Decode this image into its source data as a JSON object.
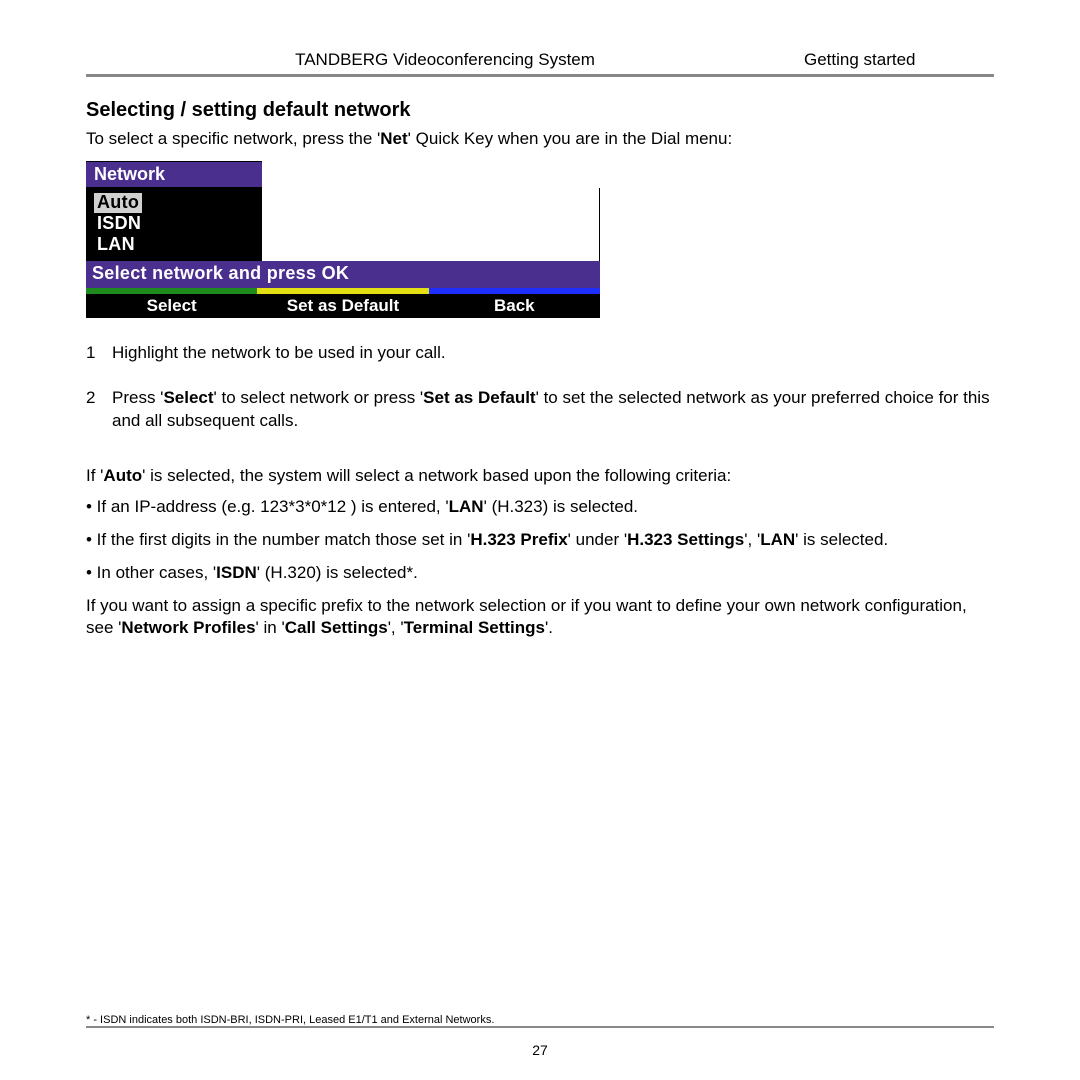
{
  "header": {
    "center": "TANDBERG Videoconferencing System",
    "right": "Getting started"
  },
  "heading": "Selecting / setting default network",
  "intro": {
    "pre": "To select a specific network, press the '",
    "bold": "Net",
    "post": "' Quick Key when you are in the Dial menu:"
  },
  "screenshot": {
    "title": "Network",
    "options": [
      "Auto",
      "ISDN",
      "LAN"
    ],
    "selected_index": 0,
    "prompt": "Select network and press OK",
    "buttons": [
      "Select",
      "Set as Default",
      "Back"
    ]
  },
  "steps": [
    {
      "num": "1",
      "pre": "Highlight the network to be used in your call."
    },
    {
      "num": "2",
      "pre": "Press '",
      "b1": "Select",
      "mid": "' to select network or press '",
      "b2": "Set as Default",
      "post": "' to set the selected network as your preferred choice for this and all subsequent calls."
    }
  ],
  "auto_line": {
    "pre": "If '",
    "b": "Auto",
    "post": "' is selected, the system will select a network based upon the following criteria:"
  },
  "bullets": [
    {
      "pre": "• If an IP-address (e.g. 123*3*0*12 ) is entered, '",
      "b": "LAN",
      "post": "' (H.323) is selected."
    },
    {
      "pre": "• If the first digits in the number match those set in '",
      "b1": "H.323 Prefix",
      "mid": "' under '",
      "b2": "H.323 Settings",
      "mid2": "', '",
      "b3": "LAN",
      "post": "' is selected."
    },
    {
      "pre": "• In other cases, '",
      "b": "ISDN",
      "post": "' (H.320) is selected*."
    }
  ],
  "closing": {
    "pre": "If you want to assign a specific prefix to the network selection or if you want to define your own network configuration, see '",
    "b1": "Network Profiles",
    "mid1": "' in '",
    "b2": "Call Settings",
    "mid2": "', '",
    "b3": "Terminal Settings",
    "post": "'."
  },
  "footnote": "* - ISDN indicates both ISDN-BRI, ISDN-PRI, Leased E1/T1 and External Networks.",
  "page_number": "27"
}
